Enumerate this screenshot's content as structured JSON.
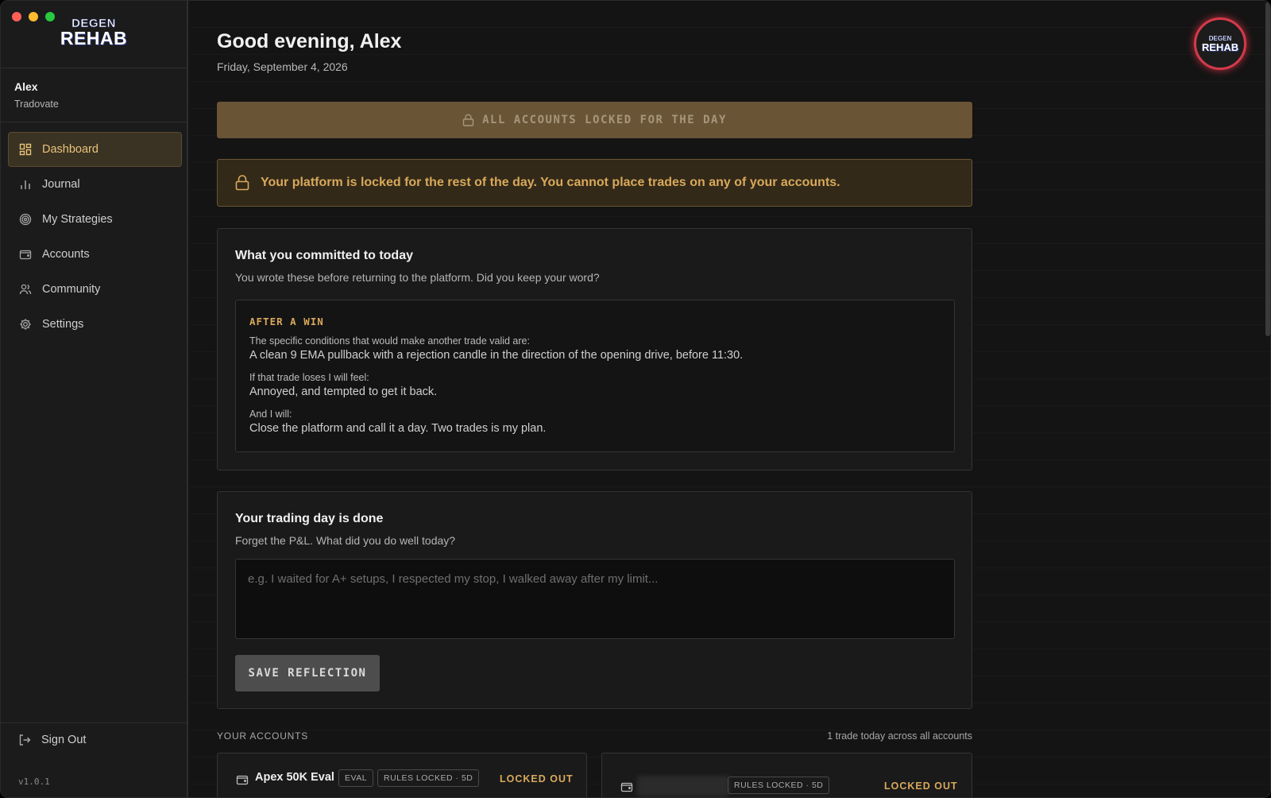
{
  "app": {
    "logo_line1": "DEGEN",
    "logo_line2": "REHAB",
    "version": "v1.0.1"
  },
  "user": {
    "name": "Alex",
    "broker": "Tradovate"
  },
  "sidebar": {
    "items": [
      {
        "label": "Dashboard",
        "icon": "dashboard-icon",
        "active": true
      },
      {
        "label": "Journal",
        "icon": "bar-chart-icon",
        "active": false
      },
      {
        "label": "My Strategies",
        "icon": "target-icon",
        "active": false
      },
      {
        "label": "Accounts",
        "icon": "wallet-icon",
        "active": false
      },
      {
        "label": "Community",
        "icon": "users-icon",
        "active": false
      },
      {
        "label": "Settings",
        "icon": "gear-icon",
        "active": false
      }
    ],
    "signout_label": "Sign Out"
  },
  "header": {
    "greeting": "Good evening, Alex",
    "date": "Friday, September 4, 2026"
  },
  "lock_banner": {
    "label": "ALL ACCOUNTS LOCKED FOR THE DAY"
  },
  "alert": {
    "message": "Your platform is locked for the rest of the day. You cannot place trades on any of your accounts."
  },
  "commitment": {
    "title": "What you committed to today",
    "subtitle": "You wrote these before returning to the platform. Did you keep your word?",
    "tag": "AFTER A WIN",
    "q1": "The specific conditions that would make another trade valid are:",
    "a1": "A clean 9 EMA pullback with a rejection candle in the direction of the opening drive, before 11:30.",
    "q2": "If that trade loses I will feel:",
    "a2": "Annoyed, and tempted to get it back.",
    "q3": "And I will:",
    "a3": "Close the platform and call it a day. Two trades is my plan."
  },
  "reflection": {
    "title": "Your trading day is done",
    "subtitle": "Forget the P&L. What did you do well today?",
    "placeholder": "e.g. I waited for A+ setups, I respected my stop, I walked away after my limit...",
    "value": "",
    "save_label": "SAVE REFLECTION"
  },
  "accounts": {
    "heading": "YOUR ACCOUNTS",
    "summary": "1 trade today across all accounts",
    "items": [
      {
        "name": "Apex 50K Eval",
        "type_badge": "EVAL",
        "rules_badge": "RULES LOCKED · 5D",
        "status": "LOCKED OUT"
      },
      {
        "name": "",
        "rules_badge": "RULES LOCKED · 5D",
        "status": "LOCKED OUT"
      }
    ]
  },
  "colors": {
    "accent": "#d9a95a",
    "lock_banner_bg": "#695436",
    "alert_bg": "#322919",
    "avatar_ring": "#d43a4a"
  }
}
